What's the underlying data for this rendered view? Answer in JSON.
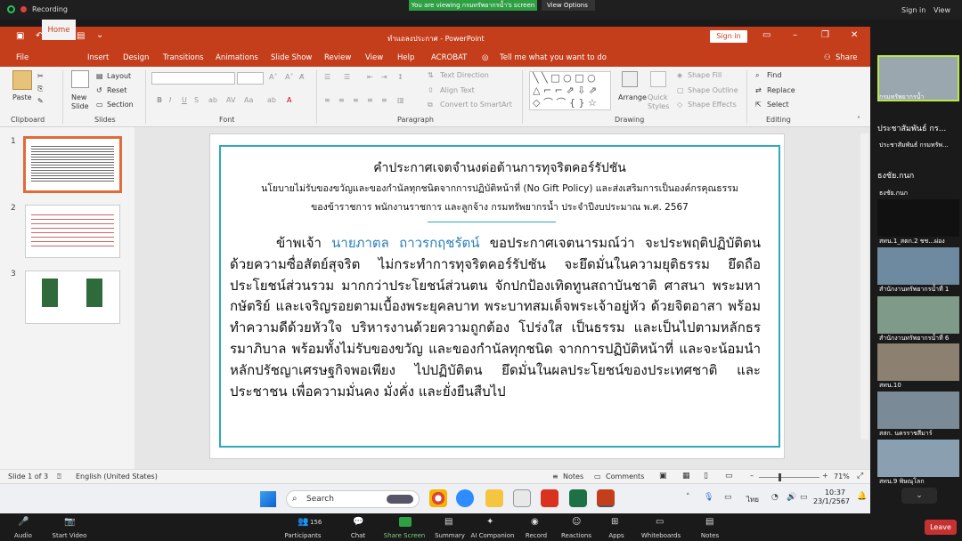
{
  "zoom_top": {
    "recording": "Recording",
    "viewing_banner": "You are viewing กรมทรัพยากรน้ำ's screen",
    "view_options": "View Options",
    "sign_in": "Sign in",
    "view": "View"
  },
  "ppt": {
    "title": "ทำแถลงประกาศ - PowerPoint",
    "sign_in": "Sign in",
    "tabs": [
      "File",
      "Home",
      "Insert",
      "Design",
      "Transitions",
      "Animations",
      "Slide Show",
      "Review",
      "View",
      "Help",
      "ACROBAT"
    ],
    "tell_me": "Tell me what you want to do",
    "share": "Share",
    "ribbon": {
      "paste": "Paste",
      "new_slide": "New Slide",
      "layout": "Layout",
      "reset": "Reset",
      "section": "Section",
      "text_direction": "Text Direction",
      "align_text": "Align Text",
      "convert_smartart": "Convert to SmartArt",
      "arrange": "Arrange",
      "quick_styles": "Quick Styles",
      "shape_fill": "Shape Fill",
      "shape_outline": "Shape Outline",
      "shape_effects": "Shape Effects",
      "find": "Find",
      "replace": "Replace",
      "select": "Select",
      "groups": [
        "Clipboard",
        "Slides",
        "Font",
        "Paragraph",
        "Drawing",
        "Editing"
      ]
    },
    "thumb_numbers": [
      "1",
      "2",
      "3"
    ],
    "slide": {
      "title": "คำประกาศเจตจำนงต่อต้านการทุจริตคอร์รัปชัน",
      "subtitle1": "นโยบายไม่รับของขวัญและของกำนัลทุกชนิดจากการปฏิบัติหน้าที่ (No Gift Policy) และส่งเสริมการเป็นองค์กรคุณธรรม",
      "subtitle2": "ของข้าราชการ พนักงานราชการ และลูกจ้าง กรมทรัพยากรน้ำ ประจำปีงบประมาณ พ.ศ. 2567",
      "body_prefix": "ข้าพเจ้า ",
      "body_name": "นายภาตล ถาวรกฤชรัตน์",
      "body_rest": " ขอประกาศเจตนารมณ์ว่า จะประพฤติปฏิบัติตน ด้วยความซื่อสัตย์สุจริต ไม่กระทำการทุจริตคอร์รัปชัน จะยึดมั่นในความยุติธรรม ยึดถือประโยชน์ส่วนรวม มากกว่าประโยชน์ส่วนตน จักปกป้องเทิดทูนสถาบันชาติ ศาสนา พระมหากษัตริย์ และเจริญรอยตามเบื้องพระยุคลบาท พระบาทสมเด็จพระเจ้าอยู่หัว ด้วยจิตอาสา พร้อมทำความดีด้วยหัวใจ บริหารงานด้วยความถูกต้อง โปร่งใส เป็นธรรม และเป็นไปตามหลักธรรมาภิบาล พร้อมทั้งไม่รับของขวัญ และของกำนัลทุกชนิด จากการปฏิบัติหน้าที่ และจะน้อมนำ หลักปรัชญาเศรษฐกิจพอเพียง ไปปฏิบัติตน ยึดมั่นในผลประโยชน์ของประเทศชาติ และประชาชน เพื่อความมั่นคง มั่งคั่ง และยั่งยืนสืบไป"
    },
    "status": {
      "slide_of": "Slide 1 of 3",
      "language": "English (United States)",
      "notes": "Notes",
      "comments": "Comments",
      "zoom": "71%"
    }
  },
  "taskbar": {
    "search": "Search",
    "lang": "ไทย",
    "time": "10:37",
    "date": "23/1/2567"
  },
  "zoom_right": {
    "tile1": "กรมทรัพยากรน้ำ",
    "name1": "ประชาสัมพันธ์ กร...",
    "name1b": "ประชาสัมพันธ์ กรมทรัพ...",
    "name2": "ธงชัย.กนก",
    "name2b": "ธงชัย.กนก",
    "tiles": [
      "สทน.1_สตก.2 ชช...ผ่อง",
      "สำนักงานทรัพยากรน้ำที่ 1",
      "สำนักงานทรัพยากรน้ำที่ 6",
      "สทน.10",
      "สสก. นครราชสีมาร์",
      "สทน.9 พิษณุโลก"
    ]
  },
  "zoom_bottom": {
    "audio": "Audio",
    "video": "Start Video",
    "participants": "Participants",
    "participants_count": "156",
    "chat": "Chat",
    "share": "Share Screen",
    "summary": "Summary",
    "ai": "AI Companion",
    "record": "Record",
    "reactions": "Reactions",
    "apps": "Apps",
    "whiteboards": "Whiteboards",
    "notes": "Notes",
    "leave": "Leave"
  },
  "colors": {
    "ppt_red": "#c43e1c",
    "accent_teal": "#2fa8b8",
    "zoom_green": "#2ea043",
    "leave_red": "#c53131"
  }
}
